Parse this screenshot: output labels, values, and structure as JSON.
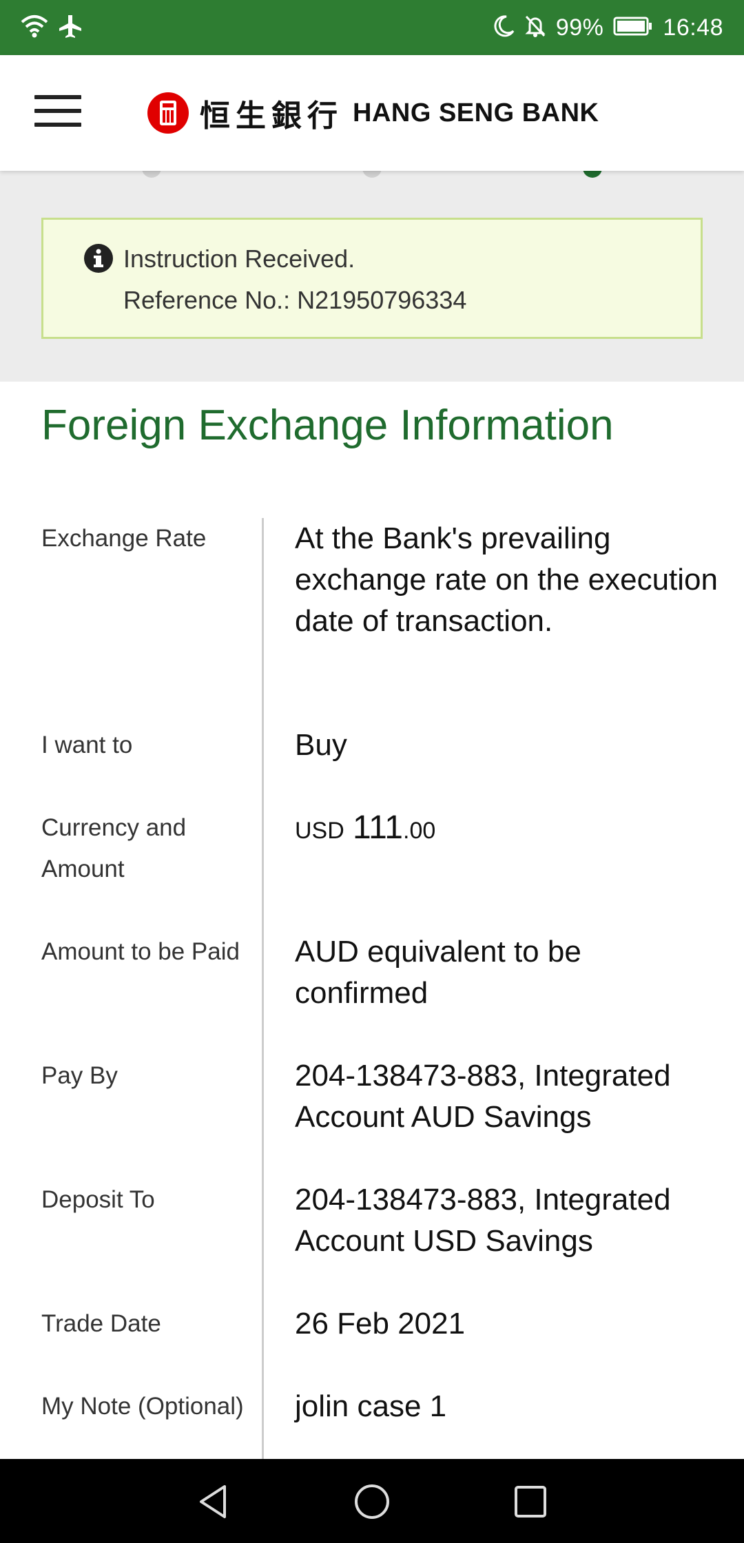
{
  "status_bar": {
    "battery_percent": "99%",
    "time": "16:48",
    "icons": [
      "wifi-icon",
      "airplane-icon",
      "moon-icon",
      "bell-off-icon",
      "battery-icon"
    ]
  },
  "header": {
    "logo_chinese": "恒生銀行",
    "logo_english": "HANG SENG BANK",
    "brand_color": "#2e7d32"
  },
  "notice": {
    "line1": "Instruction Received.",
    "line2": "Reference No.: N21950796334"
  },
  "section": {
    "title": "Foreign Exchange Information"
  },
  "details": {
    "exchange_rate": {
      "label": "Exchange Rate",
      "value": "At the Bank's prevailing exchange rate on the execution date of transaction."
    },
    "i_want_to": {
      "label": "I want to",
      "value": "Buy"
    },
    "currency_amount": {
      "label": "Currency and Amount",
      "currency": "USD",
      "integer": "111",
      "decimal": ".00"
    },
    "amount_to_be_paid": {
      "label": "Amount to be Paid",
      "value": "AUD equivalent to be confirmed"
    },
    "pay_by": {
      "label": "Pay By",
      "value": "204-138473-883, Integrated Account AUD Savings"
    },
    "deposit_to": {
      "label": "Deposit To",
      "value": "204-138473-883, Integrated Account USD Savings"
    },
    "trade_date": {
      "label": "Trade Date",
      "value": "26 Feb 2021"
    },
    "my_note": {
      "label": "My Note (Optional)",
      "value": "jolin case 1"
    }
  }
}
